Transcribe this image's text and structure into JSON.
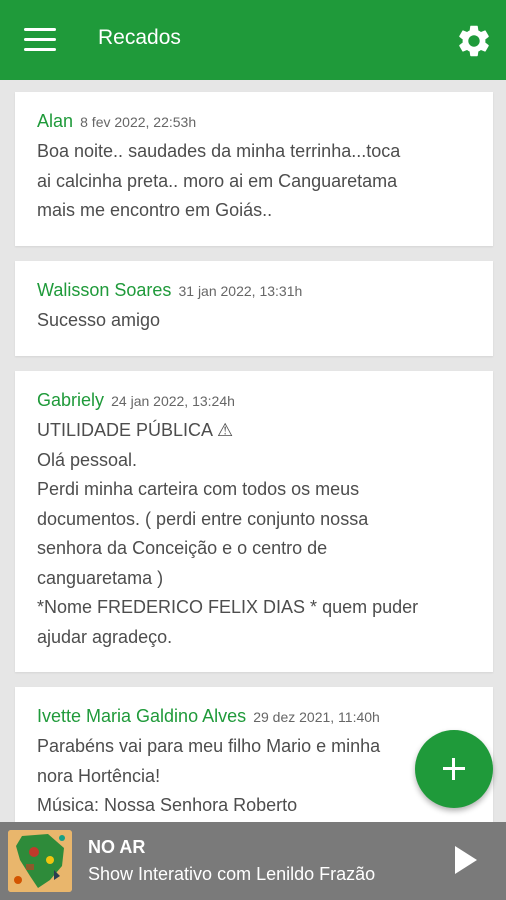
{
  "appbar": {
    "title": "Recados",
    "menu_icon": "menu-icon",
    "settings_icon": "gear-icon",
    "color": "#1f9a3a"
  },
  "posts": [
    {
      "author": "Alan",
      "date": "8 fev 2022, 22:53h",
      "lines": [
        "Boa noite.. saudades da minha terrinha...toca",
        "ai calcinha preta.. moro ai em Canguaretama",
        "mais me encontro em Goiás.."
      ]
    },
    {
      "author": "Walisson Soares",
      "date": "31 jan 2022, 13:31h",
      "lines": [
        "Sucesso amigo"
      ]
    },
    {
      "author": "Gabriely",
      "date": "24 jan 2022, 13:24h",
      "lines": [
        "UTILIDADE PÚBLICA ⚠",
        "Olá pessoal.",
        "Perdi  minha carteira com todos os meus",
        "documentos.   ( perdi entre  conjunto nossa",
        "senhora  da Conceição  e o  centro de",
        "canguaretama  )",
        "*Nome FREDERICO FELIX DIAS * quem puder",
        "ajudar agradeço."
      ]
    },
    {
      "author": "Ivette Maria Galdino Alves",
      "date": "29 dez 2021, 11:40h",
      "lines": [
        "Parabéns vai para meu filho Mario e minha",
        "nora Hortência!",
        "Música: Nossa Senhora Roberto"
      ]
    }
  ],
  "fab": {
    "icon": "plus-icon"
  },
  "player": {
    "status": "NO AR",
    "show": "Show Interativo com Lenildo Frazão",
    "play_icon": "play-icon"
  }
}
